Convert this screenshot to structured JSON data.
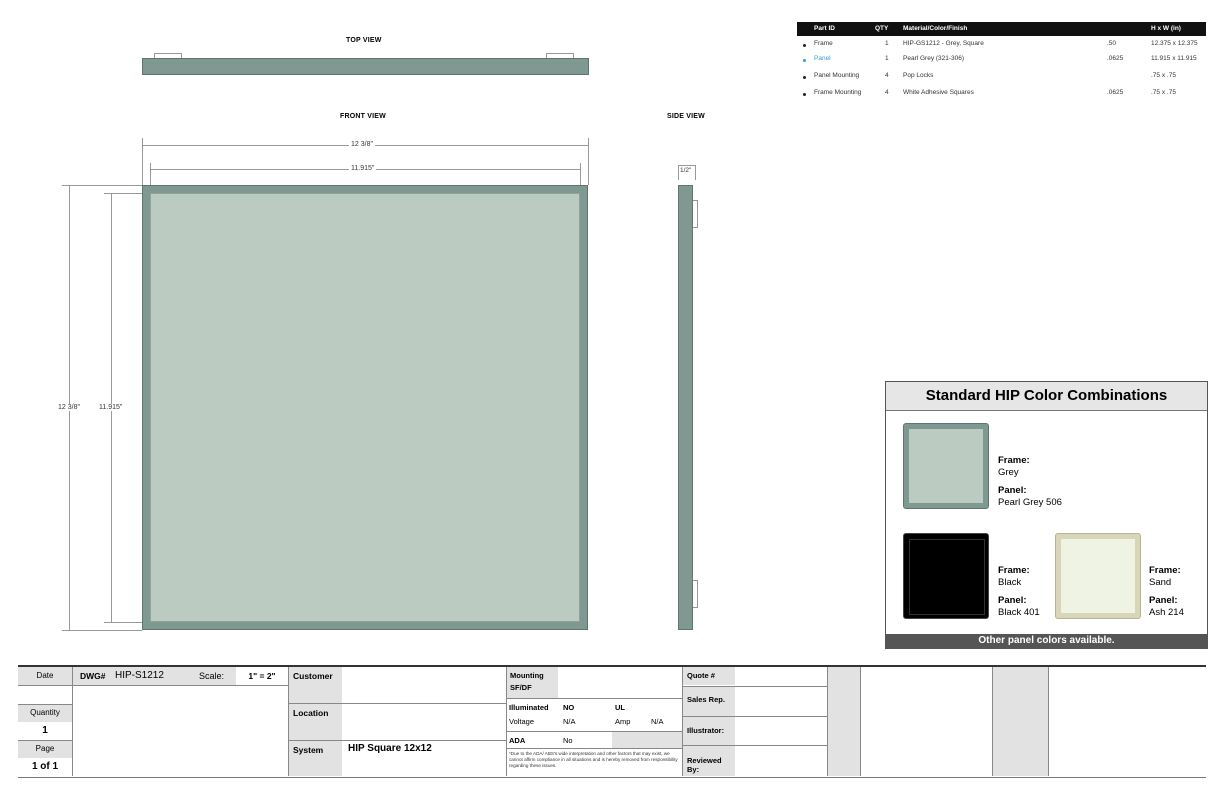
{
  "views": {
    "top": "TOP VIEW",
    "front": "FRONT VIEW",
    "side": "SIDE VIEW"
  },
  "dimensions": {
    "outer_width": "12 3/8\"",
    "inner_width": "11.915\"",
    "outer_height": "12 3/8\"",
    "inner_height": "11.915\"",
    "depth": "1/2\""
  },
  "colors": {
    "frame_grey": "#7f9892",
    "panel_pearl": "#bccbc2",
    "frame_black": "#000000",
    "panel_ash": "#eef3e4",
    "frame_sand": "#d9d5b8",
    "link_blue": "#3a9ad9"
  },
  "parts_table": {
    "headers": [
      "Part ID",
      "QTY",
      "Material/Color/Finish",
      "",
      "H x W (in)"
    ],
    "rows": [
      {
        "part": "Frame",
        "qty": "1",
        "material": "HIP-GS1212 - Grey, Square",
        "thick": ".50",
        "size": "12.375 x 12.375",
        "highlight": false
      },
      {
        "part": "Panel",
        "qty": "1",
        "material": "Pearl Grey (321-306)",
        "thick": ".0625",
        "size": "11.915 x 11.915",
        "highlight": true
      },
      {
        "part": "Panel Mounting",
        "qty": "4",
        "material": "Pop Locks",
        "thick": "",
        "size": ".75 x .75",
        "highlight": false
      },
      {
        "part": "Frame Mounting",
        "qty": "4",
        "material": "White Adhesive Squares",
        "thick": ".0625",
        "size": ".75 x .75",
        "highlight": false
      }
    ]
  },
  "combos": {
    "title": "Standard HIP Color Combinations",
    "footer": "Other panel colors available.",
    "frame_label": "Frame:",
    "panel_label": "Panel:",
    "items": [
      {
        "frame": "Grey",
        "panel": "Pearl Grey 506"
      },
      {
        "frame": "Black",
        "panel": "Black 401"
      },
      {
        "frame": "Sand",
        "panel": "Ash 214"
      }
    ]
  },
  "title_block": {
    "date_label": "Date",
    "dwg_label": "DWG#",
    "dwg_value": "HIP-S1212",
    "scale_label": "Scale:",
    "scale_value": "1\" = 2\"",
    "quantity_label": "Quantity",
    "quantity_value": "1",
    "page_label": "Page",
    "page_value": "1 of 1",
    "customer_label": "Customer",
    "location_label": "Location",
    "system_label": "System",
    "system_value": "HIP Square 12x12",
    "mounting_label": "Mounting SF/DF",
    "illuminated_label": "Illuminated",
    "illuminated_value": "NO",
    "ul_label": "UL",
    "voltage_label": "Voltage",
    "voltage_value": "N/A",
    "amp_label": "Amp",
    "amp_value": "N/A",
    "ada_label": "ADA",
    "ada_value": "No",
    "disclaimer": "*Due to the ADA/ ABS's wide interpretation and other factors that may exist, we cannot affirm compliance in all situations and is hereby removed from responsibility regarding these issues.",
    "quote_label": "Quote #",
    "sales_label": "Sales Rep.",
    "illustrator_label": "Illustrator:",
    "reviewed_label": "Reviewed By:"
  }
}
